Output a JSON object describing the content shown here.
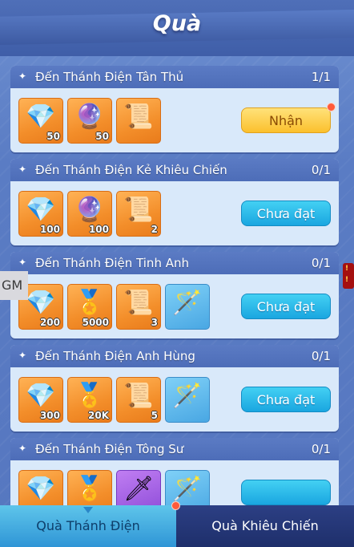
{
  "title": "Quà",
  "gm_label": "GM",
  "alert_badge": [
    "!",
    "!"
  ],
  "cards": [
    {
      "title": "Đến Thánh Điện Tân Thủ",
      "progress": "1/1",
      "button": "Nhận",
      "button_state": "claim",
      "has_dot": true,
      "rewards": [
        {
          "icon": "diamond-icon",
          "qty": "50"
        },
        {
          "icon": "orb-icon",
          "qty": "50"
        },
        {
          "icon": "scroll-icon",
          "qty": ""
        }
      ]
    },
    {
      "title": "Đến Thánh Điện Kẻ Khiêu Chiến",
      "progress": "0/1",
      "button": "Chưa đạt",
      "button_state": "locked",
      "has_dot": false,
      "rewards": [
        {
          "icon": "diamond-icon",
          "qty": "100"
        },
        {
          "icon": "orb-icon",
          "qty": "100"
        },
        {
          "icon": "scroll-icon",
          "qty": "2"
        }
      ]
    },
    {
      "title": "Đến Thánh Điện Tinh Anh",
      "progress": "0/1",
      "button": "Chưa đạt",
      "button_state": "locked",
      "has_dot": false,
      "rewards": [
        {
          "icon": "diamond-icon",
          "qty": "200"
        },
        {
          "icon": "emblem-icon",
          "qty": "5000"
        },
        {
          "icon": "scroll-icon",
          "qty": "3"
        },
        {
          "icon": "staff-icon",
          "qty": ""
        }
      ]
    },
    {
      "title": "Đến Thánh Điện Anh Hùng",
      "progress": "0/1",
      "button": "Chưa đạt",
      "button_state": "locked",
      "has_dot": false,
      "rewards": [
        {
          "icon": "diamond-icon",
          "qty": "300"
        },
        {
          "icon": "emblem-icon",
          "qty": "20K"
        },
        {
          "icon": "scroll-icon",
          "qty": "5"
        },
        {
          "icon": "staff-icon",
          "qty": ""
        }
      ]
    },
    {
      "title": "Đến Thánh Điện Tông Sư",
      "progress": "0/1",
      "button": "",
      "button_state": "locked",
      "has_dot": false,
      "rewards": [
        {
          "icon": "diamond-icon",
          "qty": ""
        },
        {
          "icon": "emblem-icon",
          "qty": ""
        },
        {
          "icon": "blade-icon",
          "qty": ""
        },
        {
          "icon": "staff-icon",
          "qty": ""
        }
      ]
    }
  ],
  "tabs": [
    {
      "label": "Quà Thánh Điện",
      "active": true
    },
    {
      "label": "Quà Khiêu Chiến",
      "active": false
    }
  ],
  "colors": {
    "claim_button": "#fbc02d",
    "locked_button": "#1aa6e0",
    "notification_dot": "#ff5a3a",
    "active_tab": "#2f95d6"
  }
}
